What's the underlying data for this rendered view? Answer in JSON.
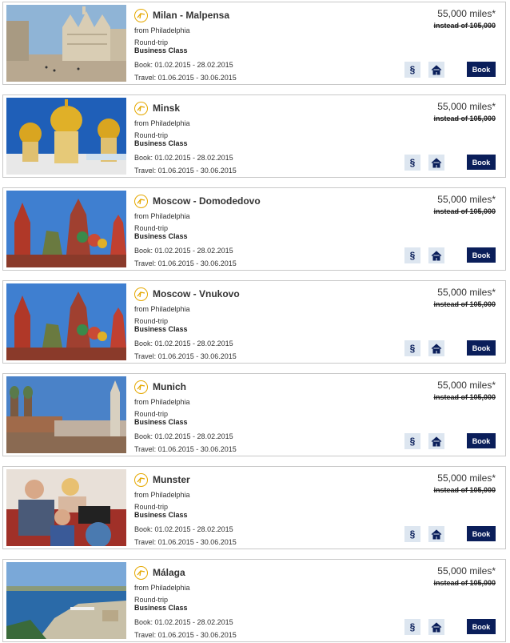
{
  "offers": [
    {
      "destination": "Milan - Malpensa",
      "from": "from Philadelphia",
      "trip": "Round-trip",
      "class": "Business Class",
      "book": "Book: 01.02.2015 - 28.02.2015",
      "travel": "Travel: 01.06.2015 - 30.06.2015",
      "price": "55,000 miles*",
      "was": "instead of 105,000",
      "book_label": "Book",
      "terms_label": "§",
      "image": "milan-cathedral"
    },
    {
      "destination": "Minsk",
      "from": "from Philadelphia",
      "trip": "Round-trip",
      "class": "Business Class",
      "book": "Book: 01.02.2015 - 28.02.2015",
      "travel": "Travel: 01.06.2015 - 30.06.2015",
      "price": "55,000 miles*",
      "was": "instead of 105,000",
      "book_label": "Book",
      "terms_label": "§",
      "image": "golden-domes"
    },
    {
      "destination": "Moscow - Domodedovo",
      "from": "from Philadelphia",
      "trip": "Round-trip",
      "class": "Business Class",
      "book": "Book: 01.02.2015 - 28.02.2015",
      "travel": "Travel: 01.06.2015 - 30.06.2015",
      "price": "55,000 miles*",
      "was": "instead of 105,000",
      "book_label": "Book",
      "terms_label": "§",
      "image": "kremlin"
    },
    {
      "destination": "Moscow - Vnukovo",
      "from": "from Philadelphia",
      "trip": "Round-trip",
      "class": "Business Class",
      "book": "Book: 01.02.2015 - 28.02.2015",
      "travel": "Travel: 01.06.2015 - 30.06.2015",
      "price": "55,000 miles*",
      "was": "instead of 105,000",
      "book_label": "Book",
      "terms_label": "§",
      "image": "kremlin"
    },
    {
      "destination": "Munich",
      "from": "from Philadelphia",
      "trip": "Round-trip",
      "class": "Business Class",
      "book": "Book: 01.02.2015 - 28.02.2015",
      "travel": "Travel: 01.06.2015 - 30.06.2015",
      "price": "55,000 miles*",
      "was": "instead of 105,000",
      "book_label": "Book",
      "terms_label": "§",
      "image": "munich-skyline"
    },
    {
      "destination": "Munster",
      "from": "from Philadelphia",
      "trip": "Round-trip",
      "class": "Business Class",
      "book": "Book: 01.02.2015 - 28.02.2015",
      "travel": "Travel: 01.06.2015 - 30.06.2015",
      "price": "55,000 miles*",
      "was": "instead of 105,000",
      "book_label": "Book",
      "terms_label": "§",
      "image": "family-globe"
    },
    {
      "destination": "Málaga",
      "from": "from Philadelphia",
      "trip": "Round-trip",
      "class": "Business Class",
      "book": "Book: 01.02.2015 - 28.02.2015",
      "travel": "Travel: 01.06.2015 - 30.06.2015",
      "price": "55,000 miles*",
      "was": "instead of 105,000",
      "book_label": "Book",
      "terms_label": "§",
      "image": "malaga-harbor"
    }
  ],
  "colors": {
    "brand_navy": "#0a1e5a",
    "crane_gold": "#e5a800",
    "card_border": "#c8c8c8"
  }
}
